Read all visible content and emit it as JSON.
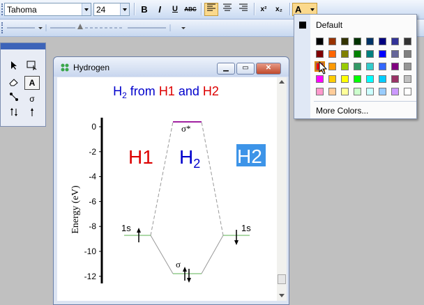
{
  "toolbar": {
    "font_name": "Tahoma",
    "font_size": "24",
    "bold_label": "B",
    "italic_label": "I",
    "underline_label": "U",
    "strike_label": "ABC",
    "superscript_label": "x²",
    "subscript_label": "x₂",
    "font_color_label": "A",
    "font_color": "#ff0000"
  },
  "tools": [
    "select-arrow",
    "marquee",
    "eraser",
    "text",
    "bond",
    "orbital",
    "double-arrow",
    "up-arrow"
  ],
  "tool_text_label": "A",
  "tool_orbital_label": "σ",
  "window": {
    "title": "Hydrogen"
  },
  "diagram": {
    "title_parts": [
      {
        "text": "H",
        "color": "#0000cc"
      },
      {
        "text": "2",
        "color": "#0000cc",
        "sub": true
      },
      {
        "text": " from ",
        "color": "#0000cc"
      },
      {
        "text": "H1",
        "color": "#dd0000"
      },
      {
        "text": " and ",
        "color": "#0000cc"
      },
      {
        "text": "H2",
        "color": "#dd0000"
      }
    ],
    "label_h1": "H1",
    "label_h2mol": "H",
    "label_h2mol_sub": "2",
    "label_h2_selected": "H2",
    "ylabel": "Energy (eV)",
    "yticks": [
      "0",
      "-2",
      "-4",
      "-6",
      "-8",
      "-10",
      "-12"
    ],
    "left_orbital": "1s",
    "right_orbital": "1s",
    "sigma_star": "σ*",
    "sigma": "σ"
  },
  "color_menu": {
    "default_label": "Default",
    "more_colors_label": "More Colors...",
    "selected_color": "#ff0000",
    "colors": [
      [
        "#000000",
        "#993300",
        "#333300",
        "#003300",
        "#003366",
        "#000080",
        "#333399",
        "#333333"
      ],
      [
        "#800000",
        "#ff6600",
        "#808000",
        "#008000",
        "#008080",
        "#0000ff",
        "#666699",
        "#808080"
      ],
      [
        "#ff0000",
        "#ff9900",
        "#99cc00",
        "#339966",
        "#33cccc",
        "#3366ff",
        "#800080",
        "#969696"
      ],
      [
        "#ff00ff",
        "#ffcc00",
        "#ffff00",
        "#00ff00",
        "#00ffff",
        "#00ccff",
        "#993366",
        "#c0c0c0"
      ],
      [
        "#ff99cc",
        "#ffcc99",
        "#ffff99",
        "#ccffcc",
        "#ccffff",
        "#99ccff",
        "#cc99ff",
        "#ffffff"
      ]
    ]
  }
}
